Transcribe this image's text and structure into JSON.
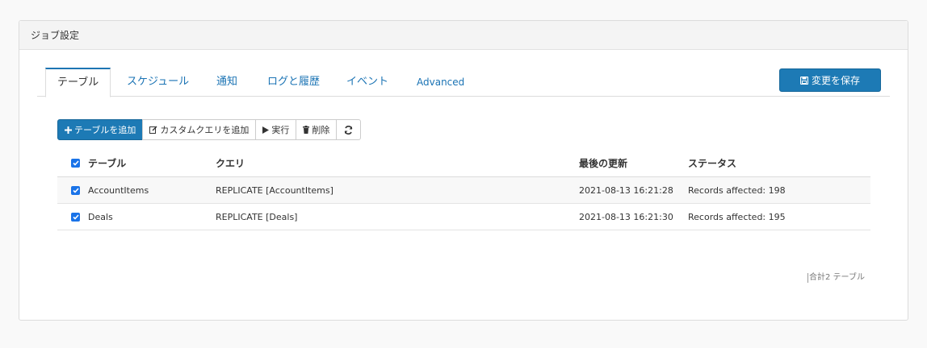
{
  "panel": {
    "title": "ジョブ設定"
  },
  "tabs": [
    {
      "label": "テーブル",
      "active": true
    },
    {
      "label": "スケジュール",
      "active": false
    },
    {
      "label": "通知",
      "active": false
    },
    {
      "label": "ログと履歴",
      "active": false
    },
    {
      "label": "イベント",
      "active": false
    },
    {
      "label": "Advanced",
      "active": false
    }
  ],
  "save_button": {
    "label": "変更を保存",
    "icon": "save-icon"
  },
  "toolbar": {
    "add_table": "テーブルを追加",
    "add_custom_query": "カスタムクエリを追加",
    "run": "実行",
    "delete": "削除",
    "refresh_icon": "refresh-icon"
  },
  "table": {
    "columns": [
      "テーブル",
      "クエリ",
      "最後の更新",
      "ステータス"
    ],
    "rows": [
      {
        "table": "AccountItems",
        "query": "REPLICATE [AccountItems]",
        "updated": "2021-08-13 16:21:28",
        "status": "Records affected: 198",
        "checked": true
      },
      {
        "table": "Deals",
        "query": "REPLICATE [Deals]",
        "updated": "2021-08-13 16:21:30",
        "status": "Records affected: 195",
        "checked": true
      }
    ]
  },
  "footer": {
    "count_text": "合計2 テーブル"
  },
  "colors": {
    "primary": "#1d7ab5",
    "link": "#1a73b4",
    "checkbox": "#1a73e8"
  }
}
